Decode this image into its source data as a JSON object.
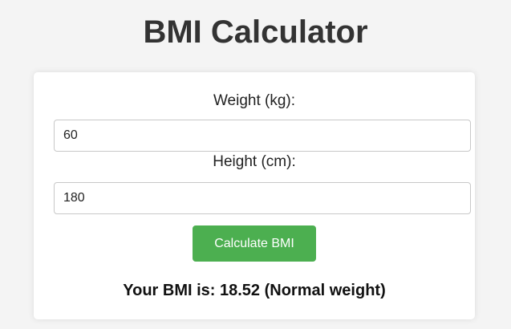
{
  "header": {
    "title": "BMI Calculator"
  },
  "form": {
    "weight_label": "Weight (kg):",
    "weight_value": "60",
    "height_label": "Height (cm):",
    "height_value": "180",
    "calculate_label": "Calculate BMI"
  },
  "result": {
    "text": "Your BMI is: 18.52 (Normal weight)"
  },
  "colors": {
    "page_background": "#f4f4f4",
    "card_background": "#ffffff",
    "button_background": "#4caf50",
    "button_text": "#ffffff",
    "title_text": "#333333"
  }
}
